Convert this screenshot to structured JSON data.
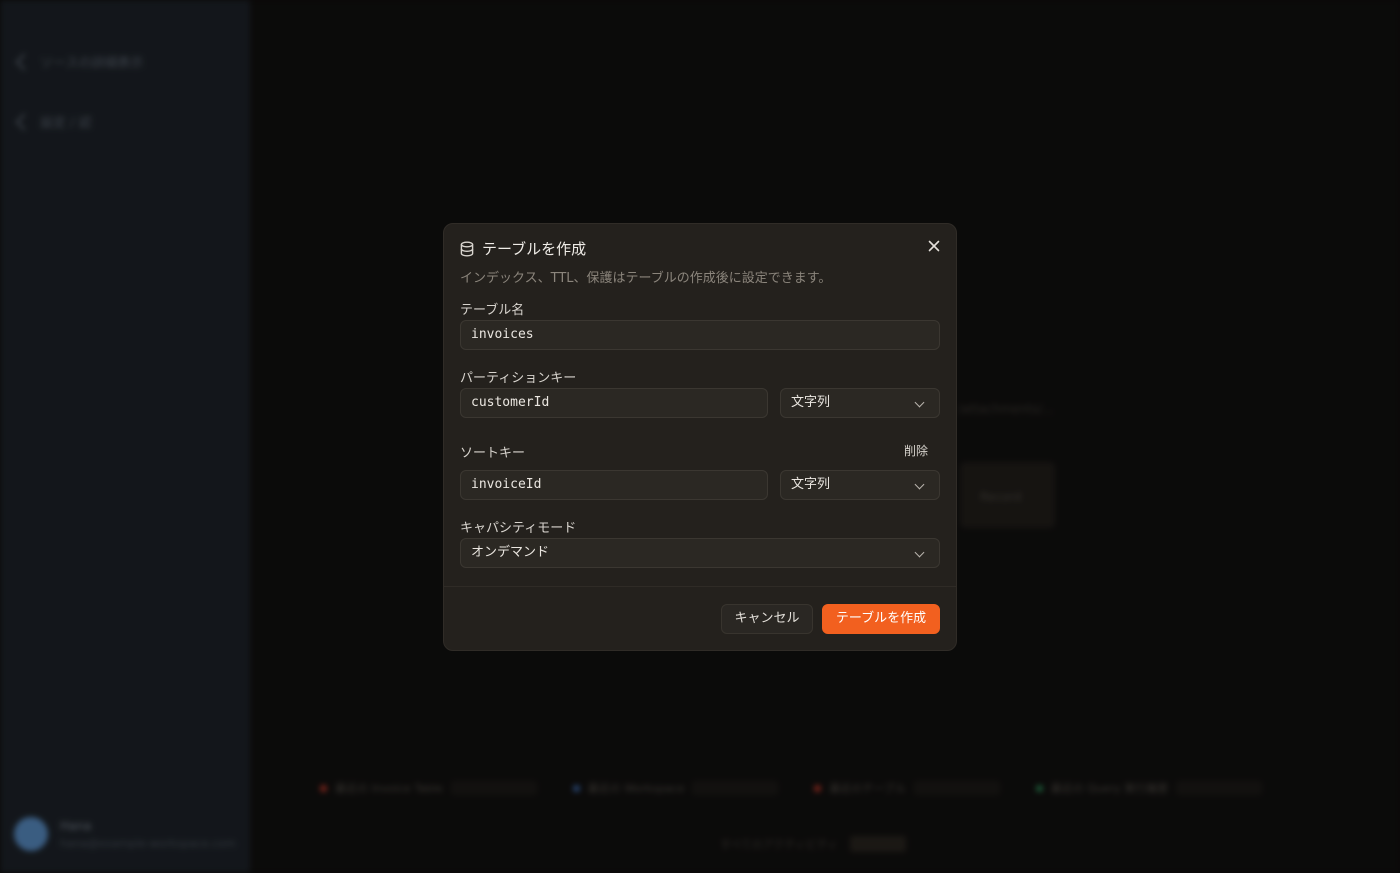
{
  "background": {
    "sidebar": {
      "items": [
        {
          "label": "ソースの詳細表示"
        },
        {
          "label": "設定 / 認"
        }
      ],
      "user": {
        "name": "Hana",
        "email": "hana@example-workspace.com"
      }
    },
    "main": {
      "hint_text": "/attachments/...",
      "card_label": "Record",
      "footer_items": [
        {
          "label": "最近の Invoice Table",
          "color": "#c0392b"
        },
        {
          "label": "最近の Workspace",
          "color": "#3f6cb0"
        },
        {
          "label": "最近のテーブル",
          "color": "#c0392b"
        },
        {
          "label": "最近の Query 実行履歴",
          "color": "#2e8b57"
        }
      ],
      "footer_note": "すべてのアクティビティ"
    }
  },
  "dialog": {
    "title": "テーブルを作成",
    "subtitle": "インデックス、TTL、保護はテーブルの作成後に設定できます。",
    "close_icon": "close-icon",
    "table_name": {
      "label": "テーブル名",
      "value": "invoices"
    },
    "partition_key": {
      "label": "パーティションキー",
      "value": "customerId",
      "type": "文字列"
    },
    "sort_key": {
      "label": "ソートキー",
      "delete_label": "削除",
      "value": "invoiceId",
      "type": "文字列"
    },
    "capacity_mode": {
      "label": "キャパシティモード",
      "value": "オンデマンド"
    },
    "cancel_label": "キャンセル",
    "create_label": "テーブルを作成",
    "accent_color": "#f2601f"
  }
}
